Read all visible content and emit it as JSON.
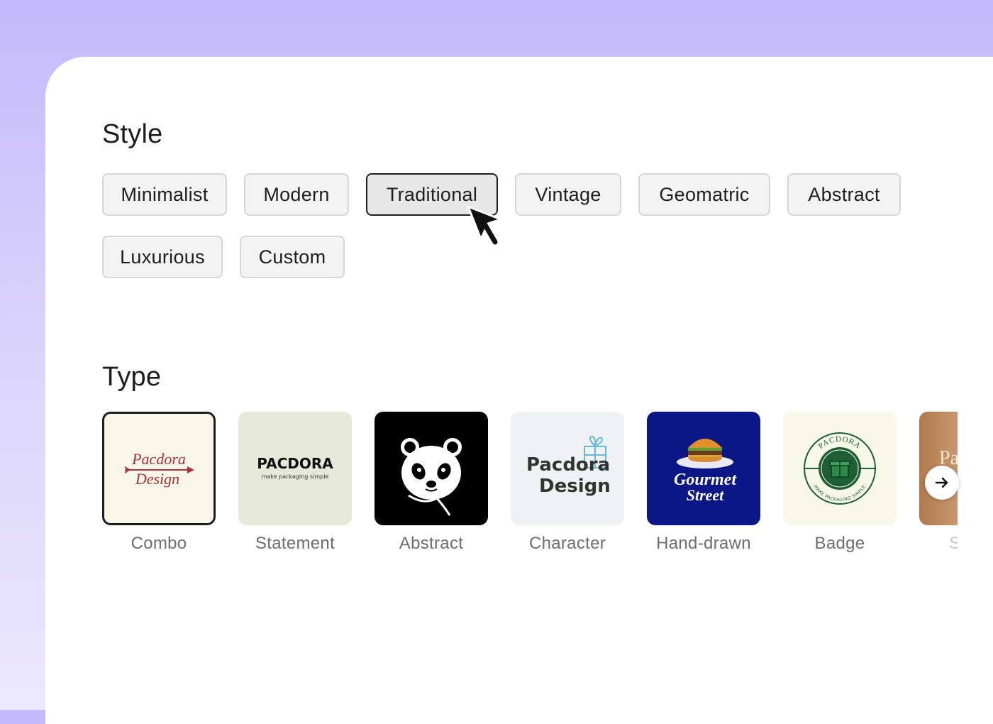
{
  "style_section": {
    "title": "Style",
    "chips": [
      {
        "label": "Minimalist",
        "selected": false
      },
      {
        "label": "Modern",
        "selected": false
      },
      {
        "label": "Traditional",
        "selected": true
      },
      {
        "label": "Vintage",
        "selected": false
      },
      {
        "label": "Geomatric",
        "selected": false
      },
      {
        "label": "Abstract",
        "selected": false
      },
      {
        "label": "Luxurious",
        "selected": false
      },
      {
        "label": "Custom",
        "selected": false
      }
    ]
  },
  "type_section": {
    "title": "Type",
    "cards": [
      {
        "label": "Combo",
        "selected": true,
        "logo_lines": [
          "Pacdora",
          "Design"
        ]
      },
      {
        "label": "Statement",
        "selected": false,
        "logo_lines": [
          "PACDORA",
          "make packaging simple"
        ]
      },
      {
        "label": "Abstract",
        "selected": false,
        "icon": "panda-icon"
      },
      {
        "label": "Character",
        "selected": false,
        "logo_lines": [
          "Pacdora",
          "Design"
        ]
      },
      {
        "label": "Hand-drawn",
        "selected": false,
        "logo_lines": [
          "Gourmet",
          "Street"
        ]
      },
      {
        "label": "Badge",
        "selected": false,
        "logo_lines": [
          "PACDORA",
          "MAKE PACKAGING SIMPLE"
        ]
      },
      {
        "label": "S",
        "selected": false,
        "logo_lines": [
          "Pa"
        ]
      }
    ],
    "next_icon": "arrow-right-icon"
  },
  "colors": {
    "background_top": "#c4b9fb",
    "panel": "#ffffff",
    "chip_border": "#d6d6d6",
    "chip_fill": "#f3f3f3",
    "selected_border": "#1e1e1e",
    "handdrawn_bg": "#0c1786",
    "badge_green": "#1d5e34",
    "combo_red": "#a8323c"
  }
}
